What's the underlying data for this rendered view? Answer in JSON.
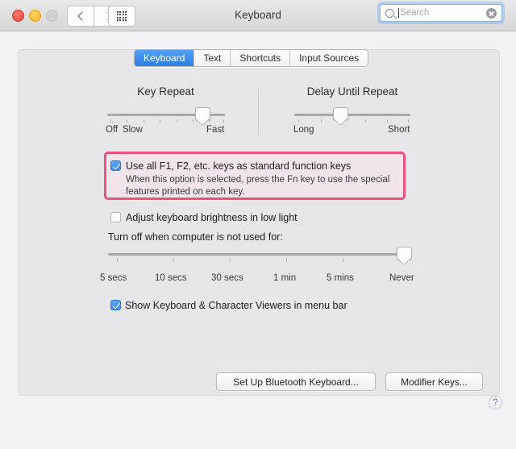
{
  "window": {
    "title": "Keyboard",
    "traffic_lights": [
      "close",
      "minimize",
      "zoom"
    ],
    "nav": {
      "back": "back-chevron",
      "forward": "forward-chevron",
      "show_all": "grid-icon"
    },
    "search": {
      "placeholder": "Search",
      "value": "",
      "clear_label": "clear"
    }
  },
  "tabs": [
    {
      "label": "Keyboard",
      "active": true
    },
    {
      "label": "Text",
      "active": false
    },
    {
      "label": "Shortcuts",
      "active": false
    },
    {
      "label": "Input Sources",
      "active": false
    }
  ],
  "key_repeat": {
    "title": "Key Repeat",
    "min_label": "Off",
    "second_label": "Slow",
    "max_label": "Fast",
    "ticks": 8,
    "value_percent": 80
  },
  "delay_until_repeat": {
    "title": "Delay Until Repeat",
    "min_label": "Long",
    "max_label": "Short",
    "ticks": 6,
    "value_percent": 40
  },
  "fn_keys_option": {
    "checked": true,
    "label": "Use all F1, F2, etc. keys as standard function keys",
    "hint": "When this option is selected, press the Fn key to use the special\nfeatures printed on each key.",
    "highlight_color": "#e8547f"
  },
  "brightness_option": {
    "checked": false,
    "label": "Adjust keyboard brightness in low light"
  },
  "turn_off_slider": {
    "label": "Turn off when computer is not used for:",
    "ticks": [
      "5 secs",
      "10 secs",
      "30 secs",
      "1 min",
      "5 mins",
      "Never"
    ],
    "selected": "Never",
    "value_percent": 100
  },
  "viewers_option": {
    "checked": true,
    "label": "Show Keyboard & Character Viewers in menu bar"
  },
  "buttons": {
    "bluetooth": "Set Up Bluetooth Keyboard...",
    "modifier": "Modifier Keys...",
    "help": "?"
  }
}
